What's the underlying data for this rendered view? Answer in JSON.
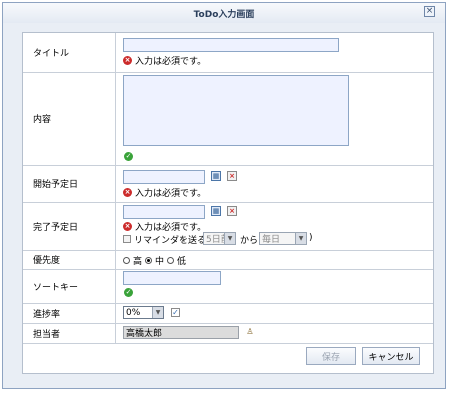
{
  "dialog": {
    "title": "ToDo入力画面",
    "close_glyph": "×"
  },
  "form": {
    "title_label": "タイトル",
    "content_label": "内容",
    "start_label": "開始予定日",
    "end_label": "完了予定日",
    "priority_label": "優先度",
    "sortkey_label": "ソートキー",
    "progress_label": "進捗率",
    "assignee_label": "担当者",
    "required_error": "入力は必須です。",
    "error_glyph": "×",
    "ok_glyph": "✓",
    "reminder": {
      "label": "リマインダを送る (",
      "days_before": "5日前",
      "kara": "から",
      "frequency": "毎日",
      "close_paren": ")"
    },
    "priority_options": [
      "高",
      "中",
      "低"
    ],
    "priority_selected": "中",
    "progress_value": "0%",
    "assignee_value": "高橋太郎"
  },
  "buttons": {
    "save": "保存",
    "cancel": "キャンセル"
  },
  "icons": {
    "calendar": "calendar-icon",
    "clear": "clear-date-icon",
    "error": "error-icon",
    "ok": "ok-check-icon",
    "user": "user-picker-icon"
  },
  "colors": {
    "error": "#cc2b2b",
    "ok": "#3aa33a",
    "input_bg": "#eef2ff"
  }
}
